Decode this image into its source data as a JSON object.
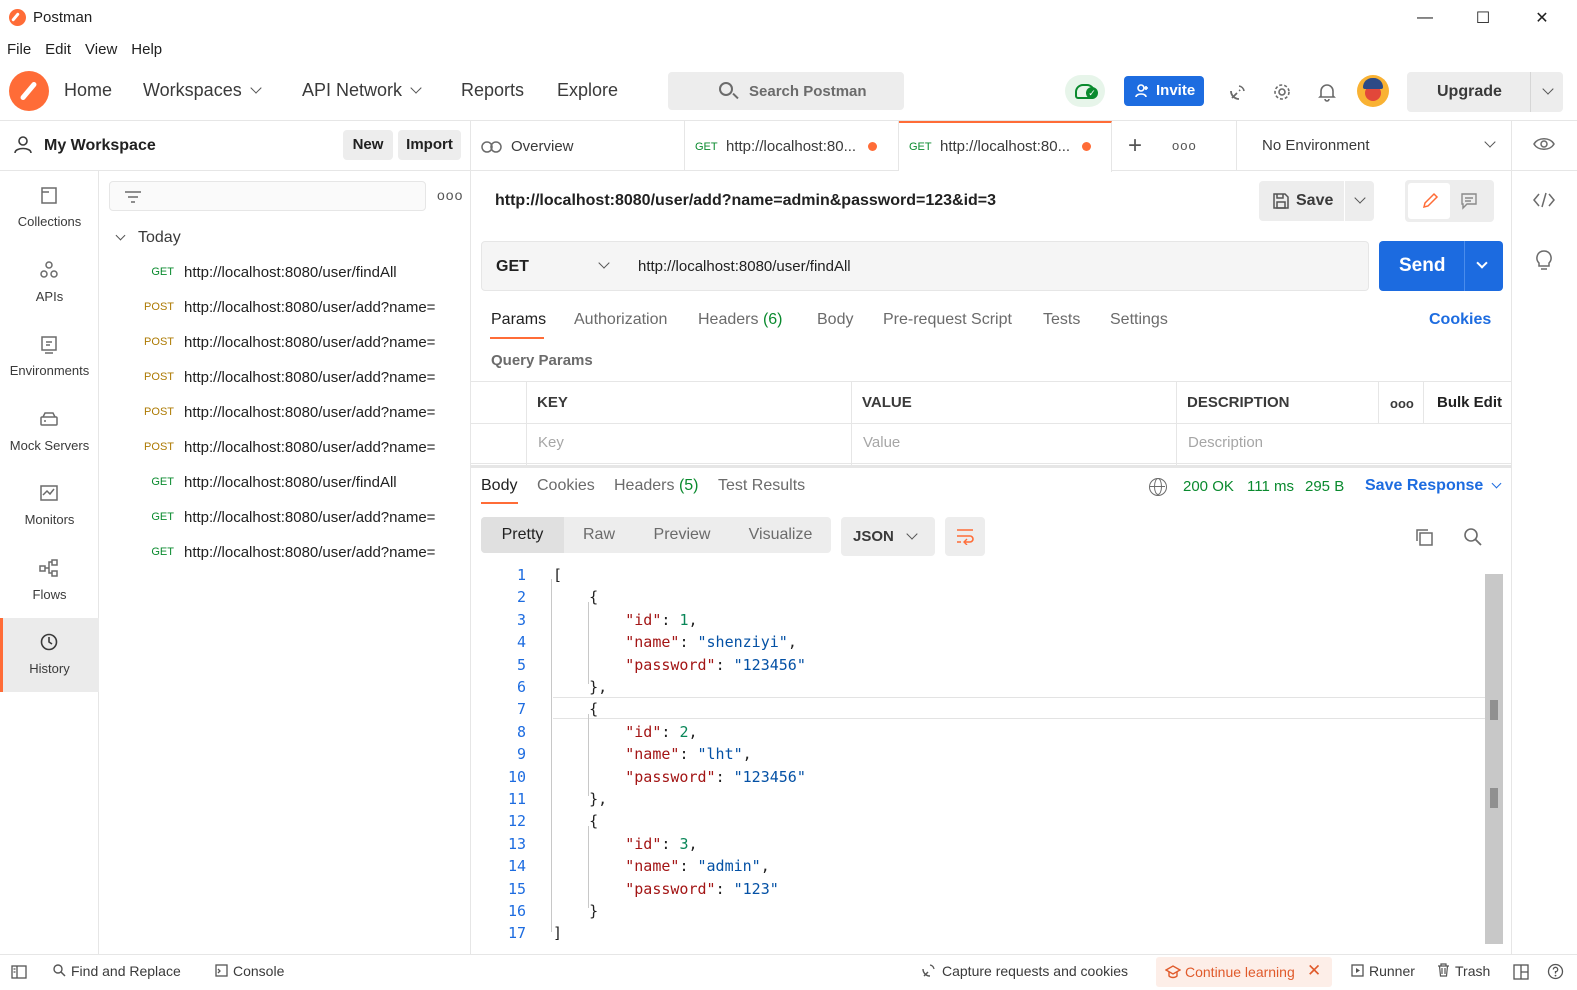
{
  "window": {
    "title": "Postman",
    "minimize": "—",
    "maximize": "☐",
    "close": "✕"
  },
  "menu": [
    "File",
    "Edit",
    "View",
    "Help"
  ],
  "header": {
    "nav": [
      "Home",
      "Workspaces",
      "API Network",
      "Reports",
      "Explore"
    ],
    "search_placeholder": "Search Postman",
    "invite_label": "Invite",
    "upgrade_label": "Upgrade"
  },
  "workspace": {
    "title": "My Workspace",
    "new_label": "New",
    "import_label": "Import"
  },
  "rail": [
    "Collections",
    "APIs",
    "Environments",
    "Mock Servers",
    "Monitors",
    "Flows",
    "History"
  ],
  "history": {
    "group": "Today",
    "items": [
      {
        "method": "GET",
        "url": "http://localhost:8080/user/findAll"
      },
      {
        "method": "POST",
        "url": "http://localhost:8080/user/add?name="
      },
      {
        "method": "POST",
        "url": "http://localhost:8080/user/add?name="
      },
      {
        "method": "POST",
        "url": "http://localhost:8080/user/add?name="
      },
      {
        "method": "POST",
        "url": "http://localhost:8080/user/add?name="
      },
      {
        "method": "POST",
        "url": "http://localhost:8080/user/add?name="
      },
      {
        "method": "GET",
        "url": "http://localhost:8080/user/findAll"
      },
      {
        "method": "GET",
        "url": "http://localhost:8080/user/add?name="
      },
      {
        "method": "GET",
        "url": "http://localhost:8080/user/add?name="
      }
    ]
  },
  "tabs": {
    "overview": "Overview",
    "items": [
      {
        "method": "GET",
        "title": "http://localhost:80..."
      },
      {
        "method": "GET",
        "title": "http://localhost:80..."
      }
    ],
    "add": "+",
    "more": "ooo",
    "environment": "No Environment"
  },
  "request": {
    "title": "http://localhost:8080/user/add?name=admin&password=123&id=3",
    "save_label": "Save",
    "method": "GET",
    "url": "http://localhost:8080/user/findAll",
    "send_label": "Send",
    "tabs": {
      "params": "Params",
      "authorization": "Authorization",
      "headers": "Headers",
      "headers_count": "(6)",
      "body": "Body",
      "prerequest": "Pre-request Script",
      "tests": "Tests",
      "settings": "Settings"
    },
    "cookies_label": "Cookies",
    "query_params_label": "Query Params",
    "params_table": {
      "headers": [
        "KEY",
        "VALUE",
        "DESCRIPTION"
      ],
      "placeholders": [
        "Key",
        "Value",
        "Description"
      ],
      "more": "ooo",
      "bulk_edit": "Bulk Edit"
    }
  },
  "response": {
    "tabs": {
      "body": "Body",
      "cookies": "Cookies",
      "headers": "Headers",
      "headers_count": "(5)",
      "test_results": "Test Results"
    },
    "status": "200 OK",
    "time": "111 ms",
    "size": "295 B",
    "save_response": "Save Response",
    "views": [
      "Pretty",
      "Raw",
      "Preview",
      "Visualize"
    ],
    "format": "JSON",
    "line_numbers": [
      "1",
      "2",
      "3",
      "4",
      "5",
      "6",
      "7",
      "8",
      "9",
      "10",
      "11",
      "12",
      "13",
      "14",
      "15",
      "16",
      "17"
    ],
    "body_json": [
      {
        "id": 1,
        "name": "shenziyi",
        "password": "123456"
      },
      {
        "id": 2,
        "name": "lht",
        "password": "123456"
      },
      {
        "id": 3,
        "name": "admin",
        "password": "123"
      }
    ]
  },
  "statusbar": {
    "find_replace": "Find and Replace",
    "console": "Console",
    "capture": "Capture requests and cookies",
    "continue_learning": "Continue learning",
    "runner": "Runner",
    "trash": "Trash"
  },
  "colors": {
    "accent": "#ff6c37",
    "primary": "#1d6ce0",
    "get": "#0a8a2e",
    "post": "#ad7a03"
  }
}
